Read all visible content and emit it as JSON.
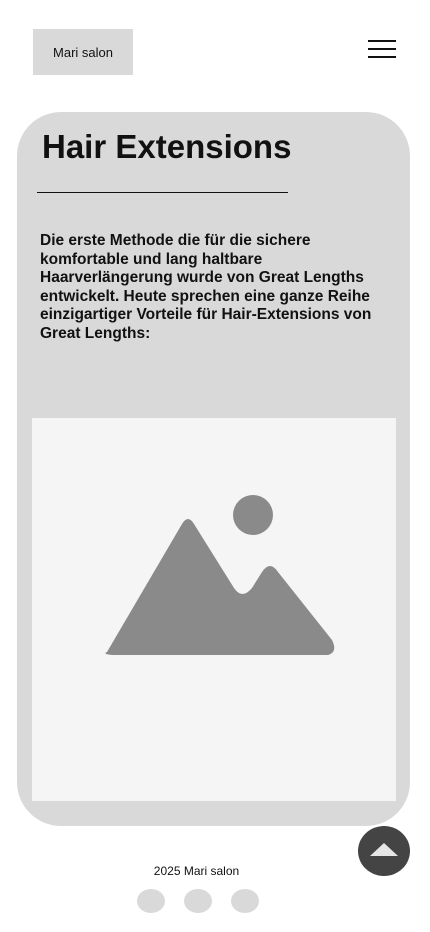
{
  "header": {
    "logo_text": "Mari salon",
    "menu_icon": "hamburger-menu-icon"
  },
  "card": {
    "title": "Hair Extensions",
    "body": "Die erste Methode die für die sichere komfortable und lang haltbare Haarverlängerung wurde von Great Lengths entwickelt. Heute sprechen eine ganze Reihe einzigartiger Vorteile für Hair-Extensions von Great Lengths:",
    "image_icon": "image-placeholder-icon"
  },
  "footer": {
    "copyright": "2025 Mari salon",
    "scroll_top_icon": "arrow-up-icon",
    "dots": [
      "dot-1",
      "dot-2",
      "dot-3"
    ]
  },
  "colors": {
    "card_background": "#d9d9d9",
    "image_background": "#f5f5f5",
    "icon_gray": "#8a8a8a",
    "scroll_button": "#444444",
    "text": "#111111"
  }
}
